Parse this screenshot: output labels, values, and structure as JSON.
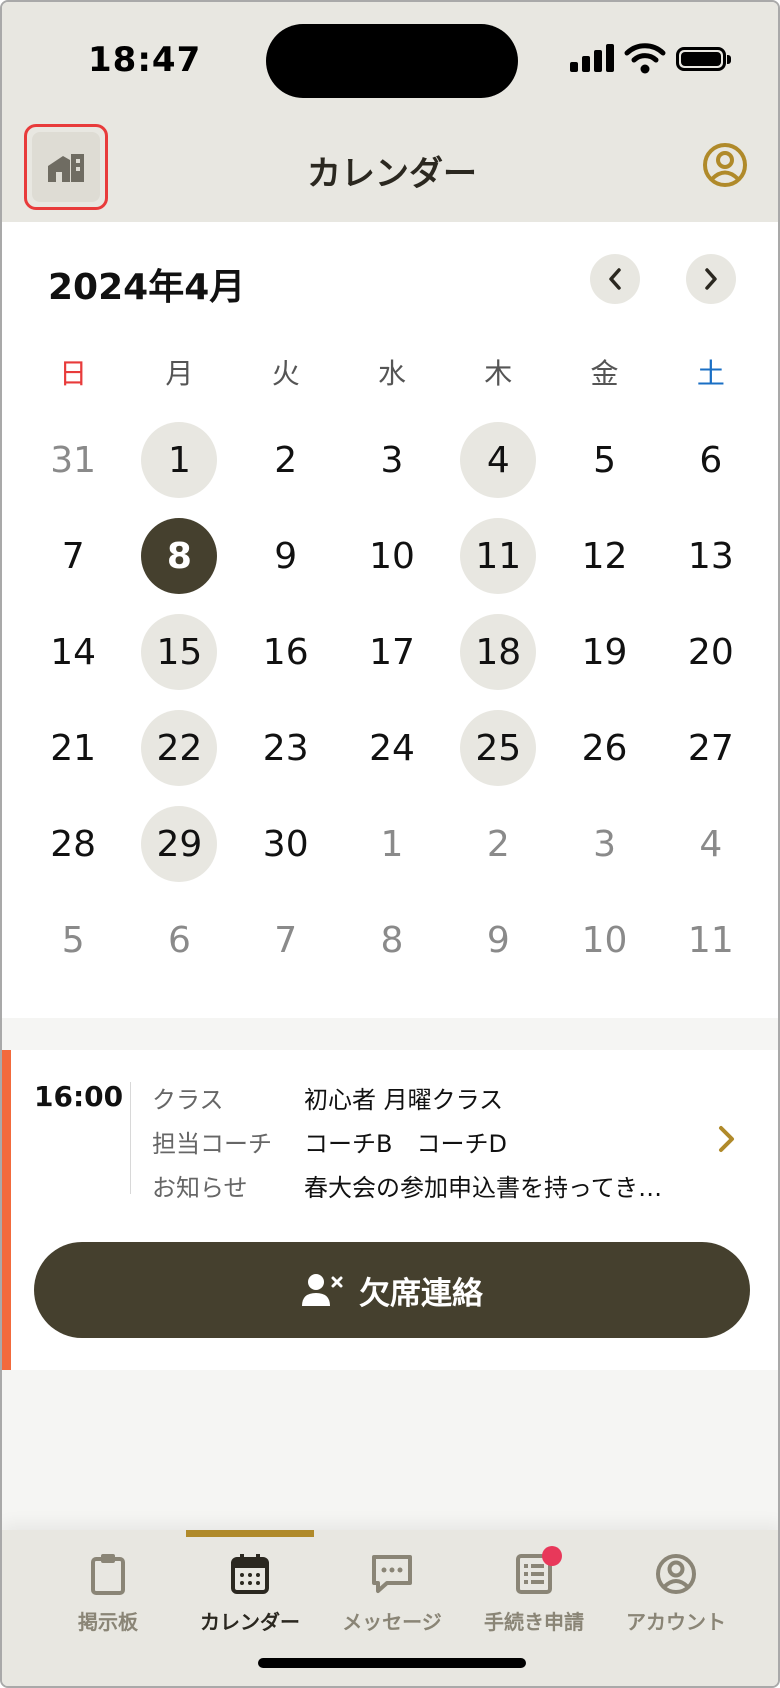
{
  "status_bar": {
    "time": "18:47"
  },
  "header": {
    "title": "カレンダー"
  },
  "calendar": {
    "month_label": "2024年4月",
    "weekdays": [
      {
        "label": "日",
        "color": "#e83b3b"
      },
      {
        "label": "月",
        "color": "#555555"
      },
      {
        "label": "火",
        "color": "#555555"
      },
      {
        "label": "水",
        "color": "#555555"
      },
      {
        "label": "木",
        "color": "#555555"
      },
      {
        "label": "金",
        "color": "#555555"
      },
      {
        "label": "土",
        "color": "#1a6fc4"
      }
    ],
    "weeks": [
      [
        {
          "d": "31",
          "s": "other"
        },
        {
          "d": "1",
          "s": "event"
        },
        {
          "d": "2",
          "s": ""
        },
        {
          "d": "3",
          "s": ""
        },
        {
          "d": "4",
          "s": "event"
        },
        {
          "d": "5",
          "s": ""
        },
        {
          "d": "6",
          "s": ""
        }
      ],
      [
        {
          "d": "7",
          "s": ""
        },
        {
          "d": "8",
          "s": "selected"
        },
        {
          "d": "9",
          "s": ""
        },
        {
          "d": "10",
          "s": ""
        },
        {
          "d": "11",
          "s": "event"
        },
        {
          "d": "12",
          "s": ""
        },
        {
          "d": "13",
          "s": ""
        }
      ],
      [
        {
          "d": "14",
          "s": ""
        },
        {
          "d": "15",
          "s": "event"
        },
        {
          "d": "16",
          "s": ""
        },
        {
          "d": "17",
          "s": ""
        },
        {
          "d": "18",
          "s": "event"
        },
        {
          "d": "19",
          "s": ""
        },
        {
          "d": "20",
          "s": ""
        }
      ],
      [
        {
          "d": "21",
          "s": ""
        },
        {
          "d": "22",
          "s": "event"
        },
        {
          "d": "23",
          "s": ""
        },
        {
          "d": "24",
          "s": ""
        },
        {
          "d": "25",
          "s": "event"
        },
        {
          "d": "26",
          "s": ""
        },
        {
          "d": "27",
          "s": ""
        }
      ],
      [
        {
          "d": "28",
          "s": ""
        },
        {
          "d": "29",
          "s": "event"
        },
        {
          "d": "30",
          "s": ""
        },
        {
          "d": "1",
          "s": "other"
        },
        {
          "d": "2",
          "s": "other"
        },
        {
          "d": "3",
          "s": "other"
        },
        {
          "d": "4",
          "s": "other"
        }
      ],
      [
        {
          "d": "5",
          "s": "other"
        },
        {
          "d": "6",
          "s": "other"
        },
        {
          "d": "7",
          "s": "other"
        },
        {
          "d": "8",
          "s": "other"
        },
        {
          "d": "9",
          "s": "other"
        },
        {
          "d": "10",
          "s": "other"
        },
        {
          "d": "11",
          "s": "other"
        }
      ]
    ]
  },
  "event": {
    "time": "16:00",
    "rows": [
      {
        "label": "クラス",
        "value": "初心者 月曜クラス"
      },
      {
        "label": "担当コーチ",
        "value": "コーチB　コーチD"
      },
      {
        "label": "お知らせ",
        "value": "春大会の参加申込書を持ってき…"
      }
    ],
    "absence_button": "欠席連絡"
  },
  "tabs": [
    {
      "label": "掲示板",
      "icon": "clipboard-icon",
      "active": false
    },
    {
      "label": "カレンダー",
      "icon": "calendar-icon",
      "active": true
    },
    {
      "label": "メッセージ",
      "icon": "message-icon",
      "active": false
    },
    {
      "label": "手続き申請",
      "icon": "form-list-icon",
      "active": false,
      "badge": true
    },
    {
      "label": "アカウント",
      "icon": "account-icon",
      "active": false
    }
  ],
  "colors": {
    "accent_dark": "#45402e",
    "accent_gold": "#b08a2a",
    "event_bar": "#f26a3c",
    "badge": "#e8385a"
  }
}
